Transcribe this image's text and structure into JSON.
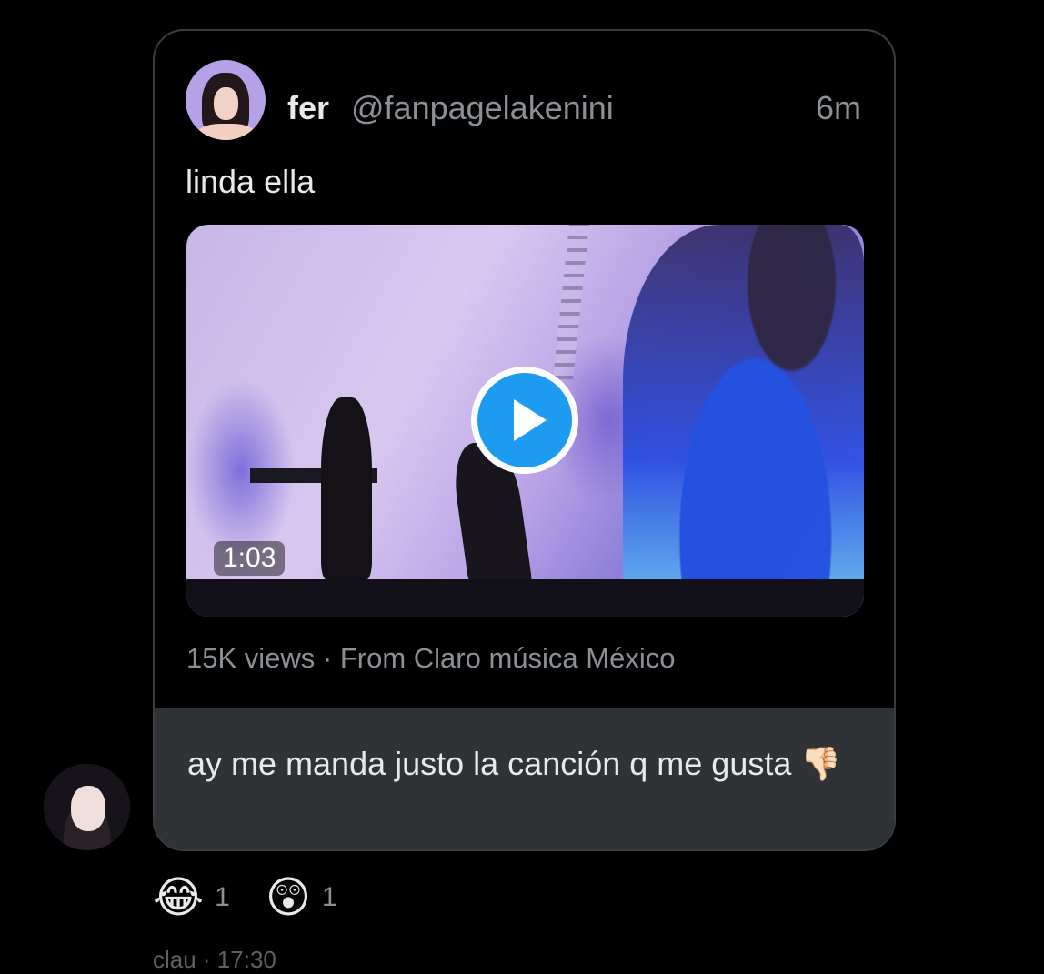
{
  "quoted_tweet": {
    "name": "fer",
    "handle": "@fanpagelakenini",
    "time": "6m",
    "text": "linda ella",
    "video": {
      "duration": "1:03",
      "accent": "#1d9bf0"
    },
    "meta": "15K views · From Claro música México"
  },
  "reply": {
    "text": "ay me manda justo la canción q me gusta 👎🏻"
  },
  "reactions": [
    {
      "emoji": "😂",
      "count": "1"
    },
    {
      "emoji": "😲",
      "count": "1"
    }
  ],
  "footer": "clau · 17:30"
}
